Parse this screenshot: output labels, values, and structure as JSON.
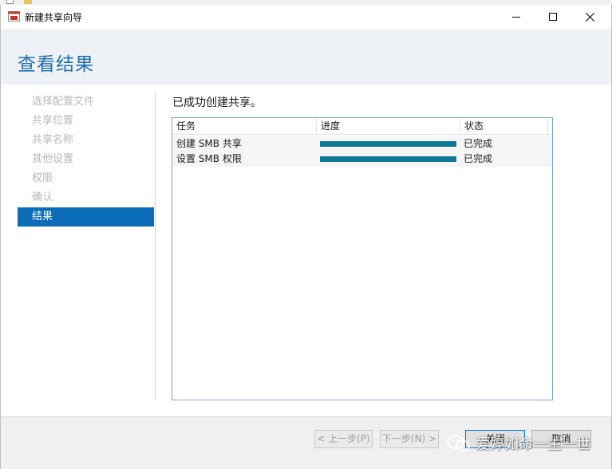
{
  "window": {
    "title": "新建共享向导"
  },
  "page": {
    "heading": "查看结果",
    "result_message": "已成功创建共享。"
  },
  "nav": {
    "items": [
      {
        "label": "选择配置文件",
        "active": false
      },
      {
        "label": "共享位置",
        "active": false
      },
      {
        "label": "共享名称",
        "active": false
      },
      {
        "label": "其他设置",
        "active": false
      },
      {
        "label": "权限",
        "active": false
      },
      {
        "label": "确认",
        "active": false
      },
      {
        "label": "结果",
        "active": true
      }
    ]
  },
  "table": {
    "headers": {
      "task": "任务",
      "progress": "进度",
      "status": "状态"
    },
    "rows": [
      {
        "task": "创建 SMB 共享",
        "progress": 1.0,
        "status": "已完成"
      },
      {
        "task": "设置 SMB 权限",
        "progress": 1.0,
        "status": "已完成"
      }
    ]
  },
  "buttons": {
    "prev": "< 上一步(P)",
    "next": "下一步(N) >",
    "close": "关闭",
    "cancel": "取消"
  },
  "watermark": {
    "text": "爱婷如命一生一世"
  },
  "colors": {
    "heading": "#1e6fa8",
    "nav_active_bg": "#0b6cb8",
    "progress_fill": "#0d7795",
    "table_border": "#7da2c9"
  }
}
